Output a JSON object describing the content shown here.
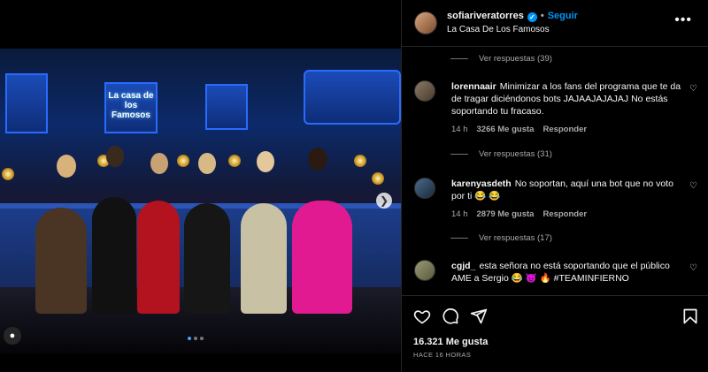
{
  "post": {
    "username": "sofiariveratorres",
    "follow_label": "Seguir",
    "location": "La Casa De Los Famosos",
    "logo_text": "La casa de los Famosos"
  },
  "comments": [
    {
      "type": "replies",
      "label": "Ver respuestas (39)"
    },
    {
      "type": "comment",
      "user": "lorennaair",
      "text": "Minimizar a los fans del programa que te da de tragar diciéndonos bots JAJAAJAJAJAJ No estás soportando tu fracaso.",
      "time": "14 h",
      "likes": "3266 Me gusta",
      "reply": "Responder"
    },
    {
      "type": "replies",
      "label": "Ver respuestas (31)"
    },
    {
      "type": "comment",
      "user": "karenyasdeth",
      "text": "No soportan, aquí una bot que no voto por ti 😂 😂",
      "time": "14 h",
      "likes": "2879 Me gusta",
      "reply": "Responder"
    },
    {
      "type": "replies",
      "label": "Ver respuestas (17)"
    },
    {
      "type": "comment",
      "user": "cgjd_",
      "text": "esta señora no está soportando que el público AME a Sergio 😂 😈 🔥 #TEAMINFIERNO"
    }
  ],
  "footer": {
    "likes": "16.321 Me gusta",
    "time": "HACE 16 HORAS"
  },
  "icons": {
    "verified": "verified-badge-icon",
    "more": "more-options-icon",
    "like": "heart-icon",
    "comment": "comment-icon",
    "share": "share-icon",
    "save": "bookmark-icon"
  },
  "colors": {
    "accent": "#0095f6",
    "background": "#000000",
    "muted_text": "#a8a8a8"
  }
}
